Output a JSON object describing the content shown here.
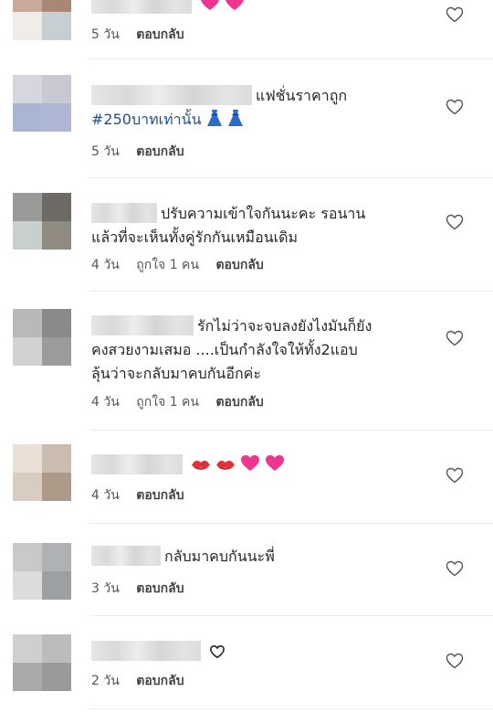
{
  "comments": [
    {
      "text": "",
      "time": "5 วัน",
      "likes": "",
      "reply": "ตอบกลับ",
      "avatar": [
        "#c9a99a",
        "#a98777",
        "#f2ece8",
        "#c7cfd2"
      ]
    },
    {
      "text": "แฟชั่นราคาถูก",
      "hashtag": "#250บาทเท่านั้น",
      "time": "5 วัน",
      "likes": "",
      "reply": "ตอบกลับ",
      "avatar": [
        "#d6d6e0",
        "#c9c9d4",
        "#a9b5d2",
        "#aeb7d4"
      ]
    },
    {
      "line1": "ปรับความเข้าใจกันนะคะ รอนาน",
      "line2": "แล้วที่จะเห็นทั้งคู่รักกันเหมือนเดิม",
      "time": "4 วัน",
      "likes": "ถูกใจ 1 คน",
      "reply": "ตอบกลับ",
      "avatar": [
        "#9a9a9a",
        "#6e6a66",
        "#c7cfcf",
        "#8f8b80"
      ]
    },
    {
      "line1": "รักไม่ว่าจะจบลงยังไงมันก็ยัง",
      "line2": "คงสวยงามเสมอ ....เป็นกำลังใจให้ทั้ง2แอบ",
      "line3": "ลุ้นว่าจะกลับมาคบกันอีกค่ะ",
      "time": "4 วัน",
      "likes": "ถูกใจ 1 คน",
      "reply": "ตอบกลับ",
      "avatar": [
        "#b9b9b9",
        "#8a8a8a",
        "#d2d2d2",
        "#9b9b9b"
      ]
    },
    {
      "text": "",
      "time": "4 วัน",
      "likes": "",
      "reply": "ตอบกลับ",
      "avatar": [
        "#ebe0d8",
        "#cbbcb0",
        "#d9ccc0",
        "#ad9a88"
      ]
    },
    {
      "text": "กลับมาคบกันนะพี่",
      "time": "3 วัน",
      "likes": "",
      "reply": "ตอบกลับ",
      "avatar": [
        "#c9c9c9",
        "#aeb2b4",
        "#dcdcdc",
        "#9da0a2"
      ]
    },
    {
      "text": "",
      "time": "2 วัน",
      "likes": "",
      "reply": "ตอบกลับ",
      "avatar": [
        "#cfcfcf",
        "#bcbcbc",
        "#aaaaaa",
        "#9a9a9a"
      ]
    }
  ],
  "icons": {
    "like": "heart-outline-icon",
    "sparkle_heart": "sparkling-heart-emoji",
    "kiss": "kiss-mark-emoji",
    "dress": "dress-emoji",
    "inline_heart": "heart-outline-emoji"
  },
  "colors": {
    "hashtag": "#1f4f8f",
    "pink_heart": "#f0358f",
    "kiss": "#e0303a"
  }
}
